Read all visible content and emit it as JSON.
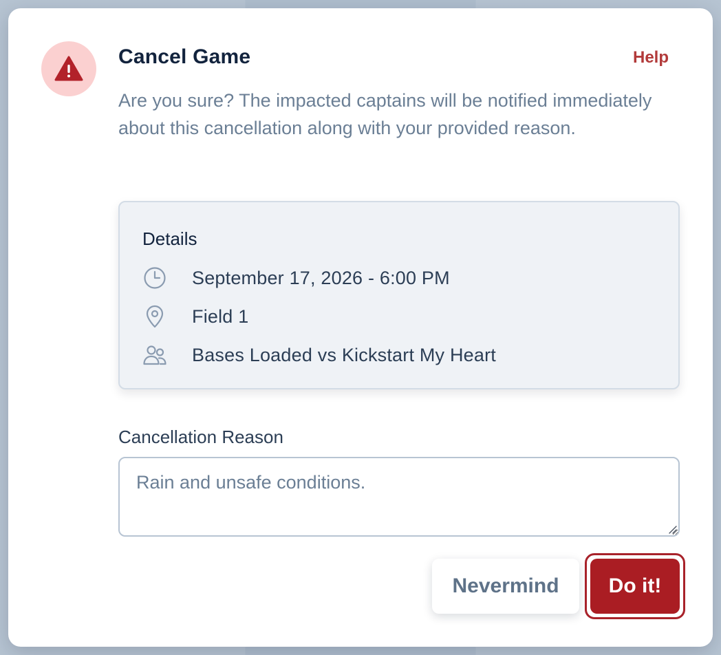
{
  "dialog": {
    "title": "Cancel Game",
    "help_label": "Help",
    "description": "Are you sure? The impacted captains will be notified immediately about this cancellation along with your provided reason."
  },
  "details": {
    "heading": "Details",
    "rows": [
      {
        "icon": "clock-icon",
        "text": "September 17, 2026 - 6:00 PM"
      },
      {
        "icon": "map-pin-icon",
        "text": "Field 1"
      },
      {
        "icon": "users-icon",
        "text": "Bases Loaded vs Kickstart My Heart"
      }
    ]
  },
  "reason": {
    "label": "Cancellation Reason",
    "value": "Rain and unsafe conditions."
  },
  "actions": {
    "cancel_label": "Nevermind",
    "confirm_label": "Do it!"
  },
  "colors": {
    "accent_danger": "#aa1d23",
    "help_link": "#b23a3a",
    "badge_bg": "#fbd0d0"
  }
}
